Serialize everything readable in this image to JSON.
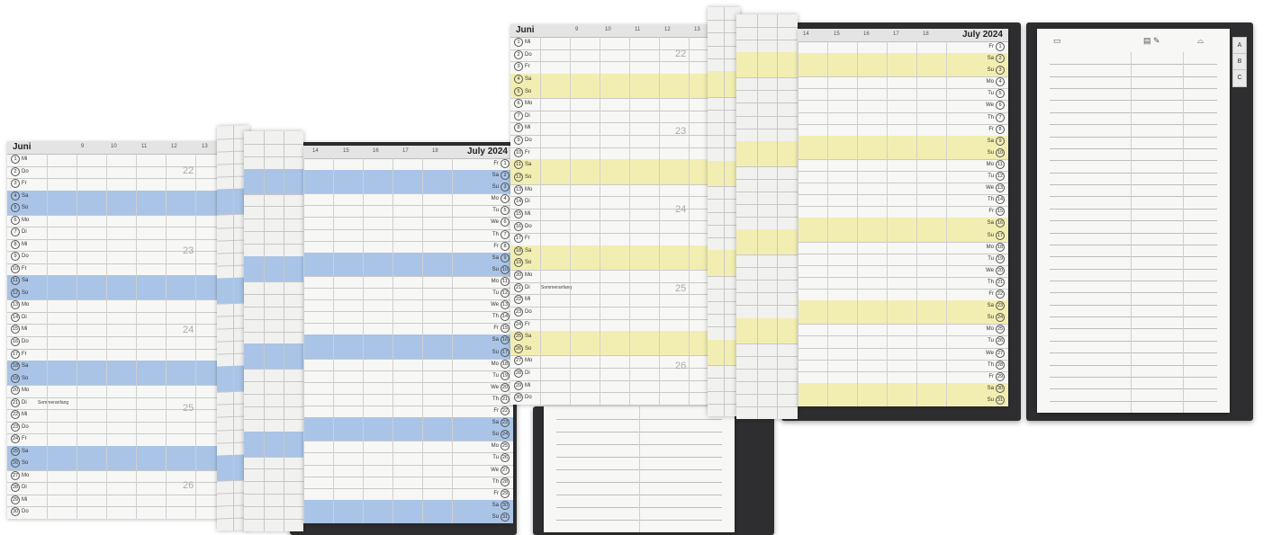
{
  "colors": {
    "blue": "#a9c4e6",
    "yellow": "#f2eeb2",
    "cover": "#2e2e30"
  },
  "planner_left": {
    "month_de": "Juni",
    "month_en": "July 2024",
    "hours_left": [
      "9",
      "10",
      "11",
      "12",
      "13"
    ],
    "hours_right": [
      "14",
      "15",
      "16",
      "17",
      "18"
    ],
    "days_de": [
      "1 Mi",
      "2 Do",
      "3 Fr",
      "4 Sa",
      "5 So",
      "6 Mo",
      "7 Di",
      "8 Mi",
      "9 Do",
      "10 Fr",
      "11 Sa",
      "12 So",
      "13 Mo",
      "14 Di",
      "15 Mi",
      "16 Do",
      "17 Fr",
      "18 Sa",
      "19 So",
      "20 Mo",
      "21 Di",
      "22 Mi",
      "23 Do",
      "24 Fr",
      "25 Sa",
      "26 So",
      "27 Mo",
      "28 Di",
      "29 Mi",
      "30 Do"
    ],
    "days_en": [
      "Fr 1",
      "Sa 2",
      "Su 3",
      "Mo 4",
      "Tu 5",
      "We 6",
      "Th 7",
      "Fr 8",
      "Sa 9",
      "Su 10",
      "Mo 11",
      "Tu 12",
      "We 13",
      "Th 14",
      "Fr 15",
      "Sa 16",
      "Su 17",
      "Mo 18",
      "Tu 19",
      "We 20",
      "Th 21",
      "Fr 22",
      "Sa 23",
      "Su 24",
      "Mo 25",
      "Tu 26",
      "We 27",
      "Th 28",
      "Fr 29",
      "Sa 30",
      "Su 31"
    ],
    "weeks": [
      "22",
      "23",
      "24",
      "25",
      "26"
    ],
    "note_21": "Sommeranfang"
  },
  "planner_right": {
    "month_de": "Juni",
    "month_en": "July 2024",
    "hours_left": [
      "9",
      "10",
      "11",
      "12",
      "13"
    ],
    "hours_right": [
      "14",
      "15",
      "16",
      "17",
      "18"
    ],
    "weeks": [
      "22",
      "23",
      "24",
      "25",
      "26"
    ],
    "note_21": "Sommeranfang",
    "tabs": [
      "A",
      "B",
      "C"
    ]
  },
  "highlight_de": [
    4,
    5,
    11,
    12,
    18,
    19,
    25,
    26
  ],
  "highlight_en": [
    2,
    3,
    9,
    10,
    16,
    17,
    23,
    24,
    30,
    31
  ]
}
